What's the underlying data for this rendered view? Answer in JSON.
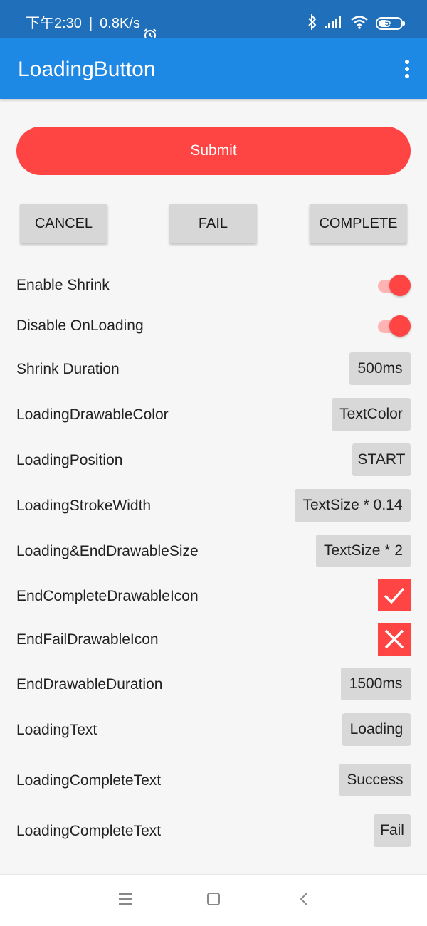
{
  "status_bar": {
    "time": "下午2:30",
    "separator": "|",
    "network_speed": "0.8K/s",
    "battery_level": "53",
    "icons": [
      "alarm-icon",
      "bluetooth-icon",
      "signal-icon",
      "wifi-icon",
      "battery-icon"
    ]
  },
  "app_bar": {
    "title": "LoadingButton",
    "menu_icon": "overflow-menu-icon"
  },
  "colors": {
    "accent": "#ff4444",
    "status_bar": "#1f6fba",
    "app_bar": "#1e88e5",
    "button_bg": "#d7d7d7",
    "switch_track": "#ffb3b3"
  },
  "submit_button": {
    "label": "Submit"
  },
  "actions": {
    "cancel": "CANCEL",
    "fail": "FAIL",
    "complete": "COMPLETE"
  },
  "settings": {
    "enable_shrink": {
      "label": "Enable Shrink",
      "on": true
    },
    "disable_on_loading": {
      "label": "Disable OnLoading",
      "on": true
    },
    "shrink_duration": {
      "label": "Shrink Duration",
      "value": "500ms"
    },
    "loading_drawable_color": {
      "label": "LoadingDrawableColor",
      "value": "TextColor"
    },
    "loading_position": {
      "label": "LoadingPosition",
      "value": "START"
    },
    "loading_stroke_width": {
      "label": "LoadingStrokeWidth",
      "value": "TextSize * 0.14"
    },
    "drawable_size": {
      "label": "Loading&EndDrawableSize",
      "value": "TextSize * 2"
    },
    "end_complete_icon": {
      "label": "EndCompleteDrawableIcon",
      "icon": "check-icon"
    },
    "end_fail_icon": {
      "label": "EndFailDrawableIcon",
      "icon": "close-icon"
    },
    "end_drawable_duration": {
      "label": "EndDrawableDuration",
      "value": "1500ms"
    },
    "loading_text": {
      "label": "LoadingText",
      "value": "Loading"
    },
    "complete_text_success": {
      "label": "LoadingCompleteText",
      "value": "Success"
    },
    "complete_text_fail": {
      "label": "LoadingCompleteText",
      "value": "Fail"
    }
  },
  "nav_bar": {
    "icons": [
      "menu-icon",
      "home-icon",
      "back-icon"
    ]
  }
}
